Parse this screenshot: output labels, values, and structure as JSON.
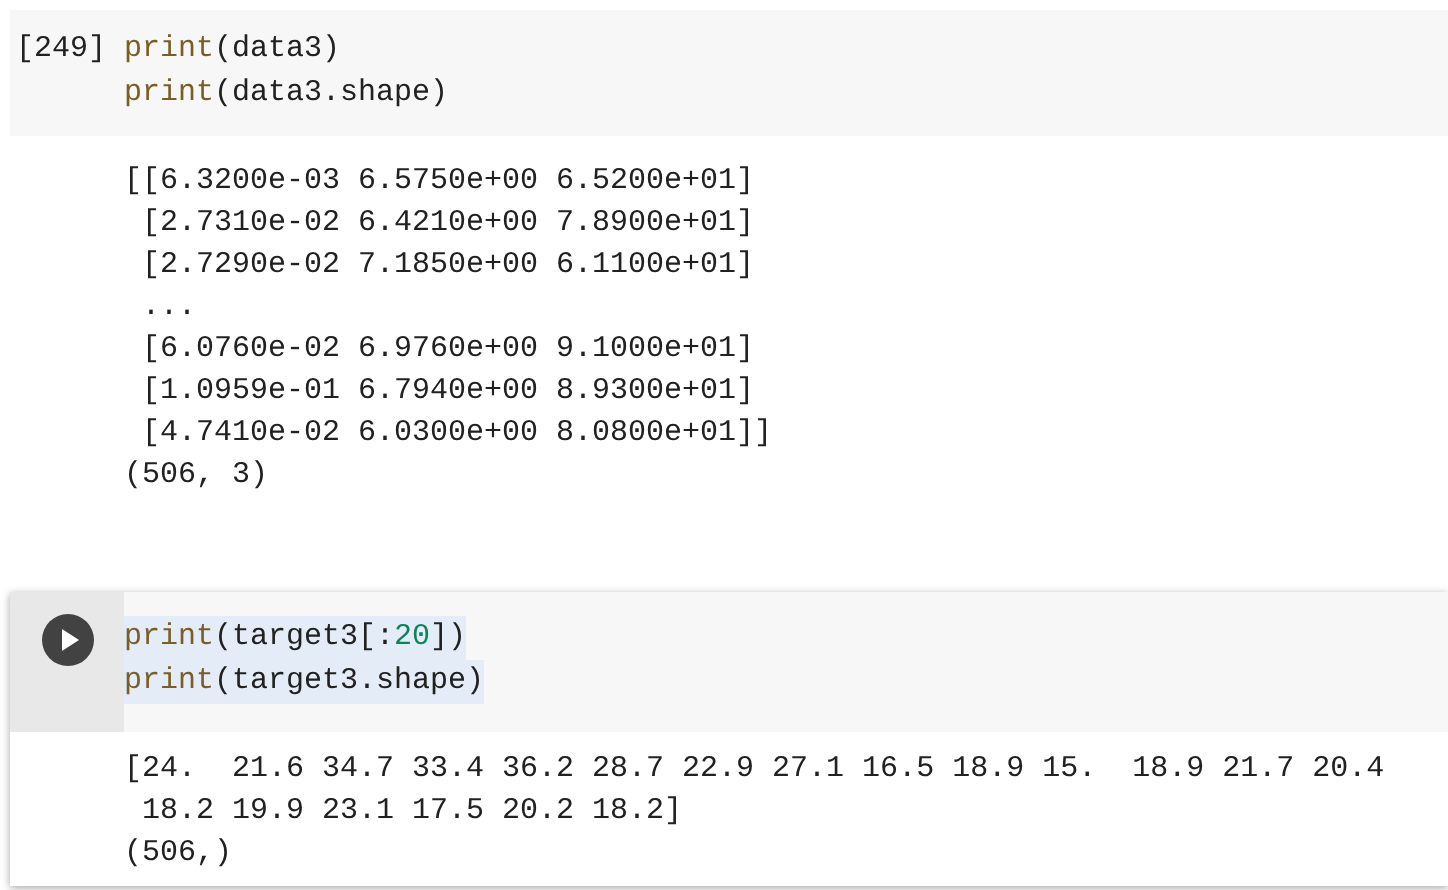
{
  "cells": [
    {
      "prompt": "[249]",
      "run_button": false,
      "focused": false,
      "code": [
        {
          "highlighted": false,
          "tokens": [
            {
              "kind": "builtin",
              "text": "print"
            },
            {
              "kind": "plain",
              "text": "(data3)"
            }
          ]
        },
        {
          "highlighted": false,
          "tokens": [
            {
              "kind": "builtin",
              "text": "print"
            },
            {
              "kind": "plain",
              "text": "(data3.shape)"
            }
          ]
        }
      ],
      "output": [
        "[[6.3200e-03 6.5750e+00 6.5200e+01]",
        " [2.7310e-02 6.4210e+00 7.8900e+01]",
        " [2.7290e-02 7.1850e+00 6.1100e+01]",
        " ...",
        " [6.0760e-02 6.9760e+00 9.1000e+01]",
        " [1.0959e-01 6.7940e+00 8.9300e+01]",
        " [4.7410e-02 6.0300e+00 8.0800e+01]]",
        "(506, 3)"
      ]
    },
    {
      "run_button": true,
      "focused": true,
      "code": [
        {
          "highlighted": true,
          "tokens": [
            {
              "kind": "builtin",
              "text": "print"
            },
            {
              "kind": "plain",
              "text": "(target3[:"
            },
            {
              "kind": "number",
              "text": "20"
            },
            {
              "kind": "plain",
              "text": "])"
            }
          ]
        },
        {
          "highlighted": true,
          "tokens": [
            {
              "kind": "builtin",
              "text": "print"
            },
            {
              "kind": "plain",
              "text": "(target3.shape)"
            }
          ]
        }
      ],
      "output": [
        "[24.  21.6 34.7 33.4 36.2 28.7 22.9 27.1 16.5 18.9 15.  18.9 21.7 20.4",
        " 18.2 19.9 23.1 17.5 20.2 18.2]",
        "(506,)"
      ]
    }
  ]
}
